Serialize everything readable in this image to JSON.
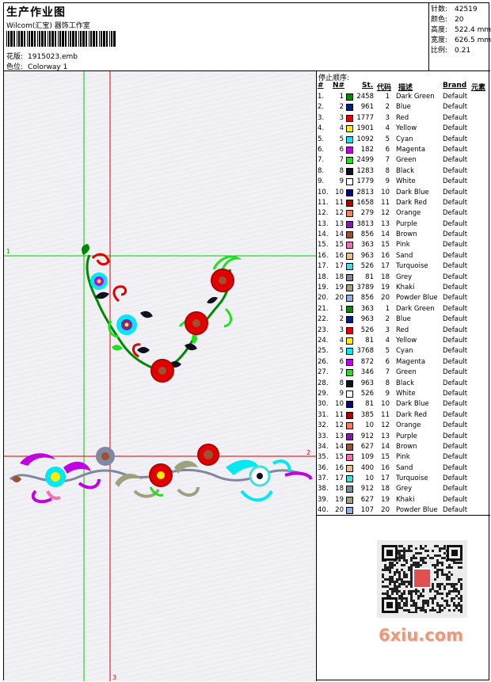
{
  "header": {
    "title": "生产作业图",
    "subtitle": "Wilcom(汇宝) 器饰工作室",
    "design_label": "花版:",
    "design_value": "1915023.emb",
    "colorway_label": "色位:",
    "colorway_value": "Colorway 1"
  },
  "stats": [
    {
      "label": "针数:",
      "value": "42519"
    },
    {
      "label": "颜色:",
      "value": "20"
    },
    {
      "label": "高度:",
      "value": "522.4 mm"
    },
    {
      "label": "宽度:",
      "value": "626.5 mm"
    },
    {
      "label": "比例:",
      "value": "0.21"
    }
  ],
  "canvas": {
    "marker_1": "1",
    "marker_2": "2",
    "marker_3": "3"
  },
  "sequence": {
    "title": "停止顺序:",
    "headers": {
      "idx": "#",
      "no": "N#",
      "st": "St.",
      "code": "代码",
      "desc": "描述",
      "brand": "Brand",
      "elem": "元素"
    },
    "rows": [
      {
        "idx": "1.",
        "no": "1",
        "color": "#008800",
        "st": "2458",
        "code": "1",
        "desc": "Dark Green",
        "brand": "Default"
      },
      {
        "idx": "2.",
        "no": "2",
        "color": "#002080",
        "st": "961",
        "code": "2",
        "desc": "Blue",
        "brand": "Default"
      },
      {
        "idx": "3.",
        "no": "3",
        "color": "#e00000",
        "st": "1777",
        "code": "3",
        "desc": "Red",
        "brand": "Default"
      },
      {
        "idx": "4.",
        "no": "4",
        "color": "#ffee00",
        "st": "1901",
        "code": "4",
        "desc": "Yellow",
        "brand": "Default"
      },
      {
        "idx": "5.",
        "no": "5",
        "color": "#00e8f0",
        "st": "1092",
        "code": "5",
        "desc": "Cyan",
        "brand": "Default"
      },
      {
        "idx": "6.",
        "no": "6",
        "color": "#c000e0",
        "st": "182",
        "code": "6",
        "desc": "Magenta",
        "brand": "Default"
      },
      {
        "idx": "7.",
        "no": "7",
        "color": "#20e020",
        "st": "2499",
        "code": "7",
        "desc": "Green",
        "brand": "Default"
      },
      {
        "idx": "8.",
        "no": "8",
        "color": "#101020",
        "st": "1283",
        "code": "8",
        "desc": "Black",
        "brand": "Default"
      },
      {
        "idx": "9.",
        "no": "9",
        "color": "#ffffff",
        "st": "1779",
        "code": "9",
        "desc": "White",
        "brand": "Default"
      },
      {
        "idx": "10.",
        "no": "10",
        "color": "#000880",
        "st": "2813",
        "code": "10",
        "desc": "Dark Blue",
        "brand": "Default"
      },
      {
        "idx": "11.",
        "no": "11",
        "color": "#b00000",
        "st": "1658",
        "code": "11",
        "desc": "Dark Red",
        "brand": "Default"
      },
      {
        "idx": "12.",
        "no": "12",
        "color": "#f08060",
        "st": "279",
        "code": "12",
        "desc": "Orange",
        "brand": "Default"
      },
      {
        "idx": "13.",
        "no": "13",
        "color": "#8020a0",
        "st": "3813",
        "code": "13",
        "desc": "Purple",
        "brand": "Default"
      },
      {
        "idx": "14.",
        "no": "14",
        "color": "#a05030",
        "st": "856",
        "code": "14",
        "desc": "Brown",
        "brand": "Default"
      },
      {
        "idx": "15.",
        "no": "15",
        "color": "#f070b0",
        "st": "363",
        "code": "15",
        "desc": "Pink",
        "brand": "Default"
      },
      {
        "idx": "16.",
        "no": "16",
        "color": "#e8c090",
        "st": "963",
        "code": "16",
        "desc": "Sand",
        "brand": "Default"
      },
      {
        "idx": "17.",
        "no": "17",
        "color": "#40e0d8",
        "st": "526",
        "code": "17",
        "desc": "Turquoise",
        "brand": "Default"
      },
      {
        "idx": "18.",
        "no": "18",
        "color": "#8088a0",
        "st": "81",
        "code": "18",
        "desc": "Grey",
        "brand": "Default"
      },
      {
        "idx": "19.",
        "no": "19",
        "color": "#a0a080",
        "st": "3789",
        "code": "19",
        "desc": "Khaki",
        "brand": "Default"
      },
      {
        "idx": "20.",
        "no": "20",
        "color": "#90b0e0",
        "st": "856",
        "code": "20",
        "desc": "Powder Blue",
        "brand": "Default"
      },
      {
        "idx": "21.",
        "no": "1",
        "color": "#008800",
        "st": "363",
        "code": "1",
        "desc": "Dark Green",
        "brand": "Default"
      },
      {
        "idx": "22.",
        "no": "2",
        "color": "#002080",
        "st": "963",
        "code": "2",
        "desc": "Blue",
        "brand": "Default"
      },
      {
        "idx": "23.",
        "no": "3",
        "color": "#e00000",
        "st": "526",
        "code": "3",
        "desc": "Red",
        "brand": "Default"
      },
      {
        "idx": "24.",
        "no": "4",
        "color": "#ffee00",
        "st": "81",
        "code": "4",
        "desc": "Yellow",
        "brand": "Default"
      },
      {
        "idx": "25.",
        "no": "5",
        "color": "#00e8f0",
        "st": "3768",
        "code": "5",
        "desc": "Cyan",
        "brand": "Default"
      },
      {
        "idx": "26.",
        "no": "6",
        "color": "#c000e0",
        "st": "872",
        "code": "6",
        "desc": "Magenta",
        "brand": "Default"
      },
      {
        "idx": "27.",
        "no": "7",
        "color": "#20e020",
        "st": "346",
        "code": "7",
        "desc": "Green",
        "brand": "Default"
      },
      {
        "idx": "28.",
        "no": "8",
        "color": "#101020",
        "st": "963",
        "code": "8",
        "desc": "Black",
        "brand": "Default"
      },
      {
        "idx": "29.",
        "no": "9",
        "color": "#ffffff",
        "st": "526",
        "code": "9",
        "desc": "White",
        "brand": "Default"
      },
      {
        "idx": "30.",
        "no": "10",
        "color": "#000880",
        "st": "81",
        "code": "10",
        "desc": "Dark Blue",
        "brand": "Default"
      },
      {
        "idx": "31.",
        "no": "11",
        "color": "#b00000",
        "st": "385",
        "code": "11",
        "desc": "Dark Red",
        "brand": "Default"
      },
      {
        "idx": "32.",
        "no": "12",
        "color": "#f08060",
        "st": "10",
        "code": "12",
        "desc": "Orange",
        "brand": "Default"
      },
      {
        "idx": "33.",
        "no": "13",
        "color": "#8020a0",
        "st": "912",
        "code": "13",
        "desc": "Purple",
        "brand": "Default"
      },
      {
        "idx": "34.",
        "no": "14",
        "color": "#a05030",
        "st": "627",
        "code": "14",
        "desc": "Brown",
        "brand": "Default"
      },
      {
        "idx": "35.",
        "no": "15",
        "color": "#f070b0",
        "st": "109",
        "code": "15",
        "desc": "Pink",
        "brand": "Default"
      },
      {
        "idx": "36.",
        "no": "16",
        "color": "#e8c090",
        "st": "400",
        "code": "16",
        "desc": "Sand",
        "brand": "Default"
      },
      {
        "idx": "37.",
        "no": "17",
        "color": "#40e0d8",
        "st": "10",
        "code": "17",
        "desc": "Turquoise",
        "brand": "Default"
      },
      {
        "idx": "38.",
        "no": "18",
        "color": "#8088a0",
        "st": "912",
        "code": "18",
        "desc": "Grey",
        "brand": "Default"
      },
      {
        "idx": "39.",
        "no": "19",
        "color": "#a0a080",
        "st": "627",
        "code": "19",
        "desc": "Khaki",
        "brand": "Default"
      },
      {
        "idx": "40.",
        "no": "20",
        "color": "#90b0e0",
        "st": "107",
        "code": "20",
        "desc": "Powder Blue",
        "brand": "Default"
      }
    ]
  },
  "watermark": "6xiu.com"
}
